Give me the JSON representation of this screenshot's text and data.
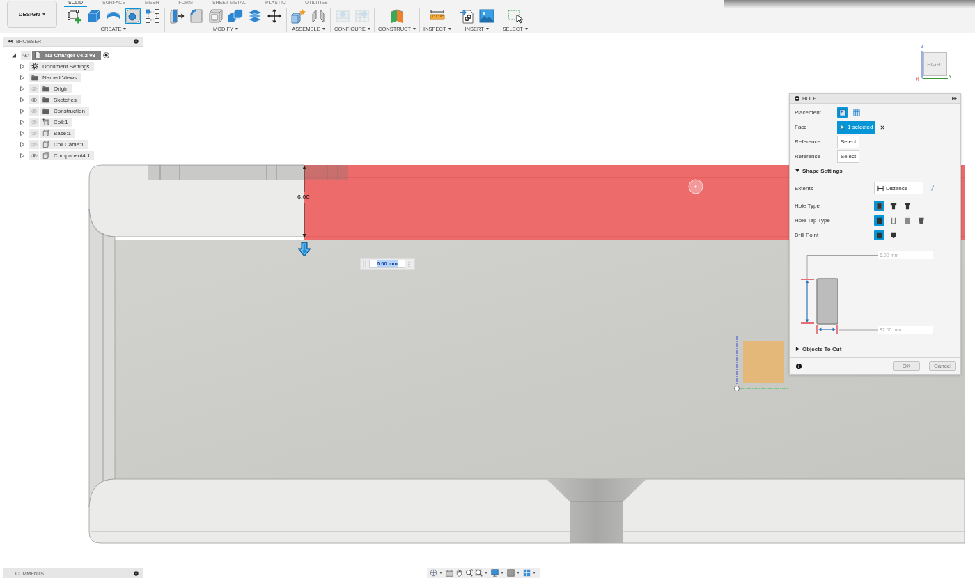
{
  "workspace_button": {
    "label": "DESIGN"
  },
  "tabs": [
    {
      "label": "SOLID",
      "selected": true
    },
    {
      "label": "SURFACE",
      "selected": false
    },
    {
      "label": "MESH",
      "selected": false
    },
    {
      "label": "FORM",
      "selected": false
    },
    {
      "label": "SHEET METAL",
      "selected": false
    },
    {
      "label": "PLASTIC",
      "selected": false
    },
    {
      "label": "UTILITIES",
      "selected": false
    }
  ],
  "toolbar_groups": [
    {
      "label": "CREATE",
      "tools": [
        {
          "kind": "sketch",
          "selected": false,
          "disabled": false
        },
        {
          "kind": "extrude",
          "selected": false,
          "disabled": false
        },
        {
          "kind": "revolve",
          "selected": false,
          "disabled": false
        },
        {
          "kind": "hole",
          "selected": true,
          "disabled": false
        },
        {
          "kind": "pattern",
          "selected": false,
          "disabled": false
        }
      ]
    },
    {
      "label": "MODIFY",
      "tools": [
        {
          "kind": "presspull",
          "selected": false,
          "disabled": false
        },
        {
          "kind": "fillet",
          "selected": false,
          "disabled": false
        },
        {
          "kind": "shell",
          "selected": false,
          "disabled": false
        },
        {
          "kind": "combine",
          "selected": false,
          "disabled": false
        },
        {
          "kind": "split",
          "selected": false,
          "disabled": false
        },
        {
          "kind": "move",
          "selected": false,
          "disabled": false
        }
      ]
    },
    {
      "label": "ASSEMBLE",
      "tools": [
        {
          "kind": "component",
          "selected": false,
          "disabled": false
        },
        {
          "kind": "joint",
          "selected": false,
          "disabled": false
        }
      ]
    },
    {
      "label": "CONFIGURE",
      "tools": [
        {
          "kind": "table",
          "selected": false,
          "disabled": true
        },
        {
          "kind": "parameters",
          "selected": false,
          "disabled": true
        }
      ]
    },
    {
      "label": "CONSTRUCT",
      "tools": [
        {
          "kind": "plane",
          "selected": false,
          "disabled": false
        }
      ]
    },
    {
      "label": "INSPECT",
      "tools": [
        {
          "kind": "measure",
          "selected": false,
          "disabled": false
        }
      ]
    },
    {
      "label": "INSERT",
      "tools": [
        {
          "kind": "derive",
          "selected": false,
          "disabled": false
        },
        {
          "kind": "image",
          "selected": false,
          "disabled": false
        }
      ]
    },
    {
      "label": "SELECT",
      "tools": [
        {
          "kind": "select",
          "selected": false,
          "disabled": false
        }
      ]
    }
  ],
  "browser": {
    "title": "BROWSER",
    "tree": [
      {
        "label": "N1 Charger v4.2 v3",
        "kind": "document",
        "expanded": true,
        "visible": true,
        "active": true,
        "children": [
          {
            "label": "Document Settings",
            "kind": "settings",
            "expanded": false,
            "active": false
          },
          {
            "label": "Named Views",
            "kind": "folder",
            "expanded": false,
            "active": false
          },
          {
            "label": "Origin",
            "kind": "folder",
            "expanded": false,
            "visible": false,
            "active": false
          },
          {
            "label": "Sketches",
            "kind": "folder",
            "expanded": false,
            "visible": true,
            "active": false
          },
          {
            "label": "Construction",
            "kind": "folder",
            "expanded": false,
            "visible": false,
            "active": false
          },
          {
            "label": "Coil:1",
            "kind": "joint",
            "expanded": false,
            "visible": false,
            "active": false
          },
          {
            "label": "Base:1",
            "kind": "component",
            "expanded": false,
            "visible": false,
            "active": false
          },
          {
            "label": "Coil Cable:1",
            "kind": "component",
            "expanded": false,
            "visible": false,
            "active": false
          },
          {
            "label": "Component4:1",
            "kind": "component",
            "expanded": false,
            "visible": true,
            "active": false
          }
        ]
      }
    ]
  },
  "viewport": {
    "dimension": "6.00",
    "distance_input": "6.00 mm"
  },
  "view_cube": {
    "face": "RIGHT",
    "z_axis": "Z",
    "x_axis": "X",
    "y_axis": "Y"
  },
  "hole_dialog": {
    "title": "HOLE",
    "fields": [
      {
        "kind": "icons",
        "label": "Placement",
        "options": [
          {
            "kind": "single",
            "selected": true
          },
          {
            "kind": "multiple",
            "selected": false
          }
        ]
      },
      {
        "kind": "selection",
        "label": "Face",
        "value": "1 selected"
      },
      {
        "kind": "select",
        "label": "Reference",
        "value": "Select"
      },
      {
        "kind": "select",
        "label": "Reference",
        "value": "Select"
      }
    ],
    "shape_settings": {
      "title": "Shape Settings",
      "expanded": true,
      "fields": [
        {
          "kind": "dropdown",
          "label": "Extents",
          "value": "Distance"
        },
        {
          "kind": "icons",
          "label": "Hole Type",
          "options": [
            {
              "kind": "simple",
              "selected": true
            },
            {
              "kind": "counterbore",
              "selected": false
            },
            {
              "kind": "countersink",
              "selected": false
            }
          ]
        },
        {
          "kind": "icons",
          "label": "Hole Tap Type",
          "options": [
            {
              "kind": "plain",
              "selected": true
            },
            {
              "kind": "clearance",
              "selected": false
            },
            {
              "kind": "tapped",
              "selected": false
            },
            {
              "kind": "taper",
              "selected": false
            }
          ]
        },
        {
          "kind": "icons",
          "label": "Drill Point",
          "options": [
            {
              "kind": "flat",
              "selected": true
            },
            {
              "kind": "angle",
              "selected": false
            }
          ]
        }
      ],
      "depth": "6.00 mm",
      "diameter": "82.00 mm"
    },
    "objects_to_cut": {
      "title": "Objects To Cut",
      "expanded": false
    },
    "buttons": [
      "OK",
      "Cancel"
    ]
  },
  "comments": {
    "title": "COMMENTS"
  }
}
